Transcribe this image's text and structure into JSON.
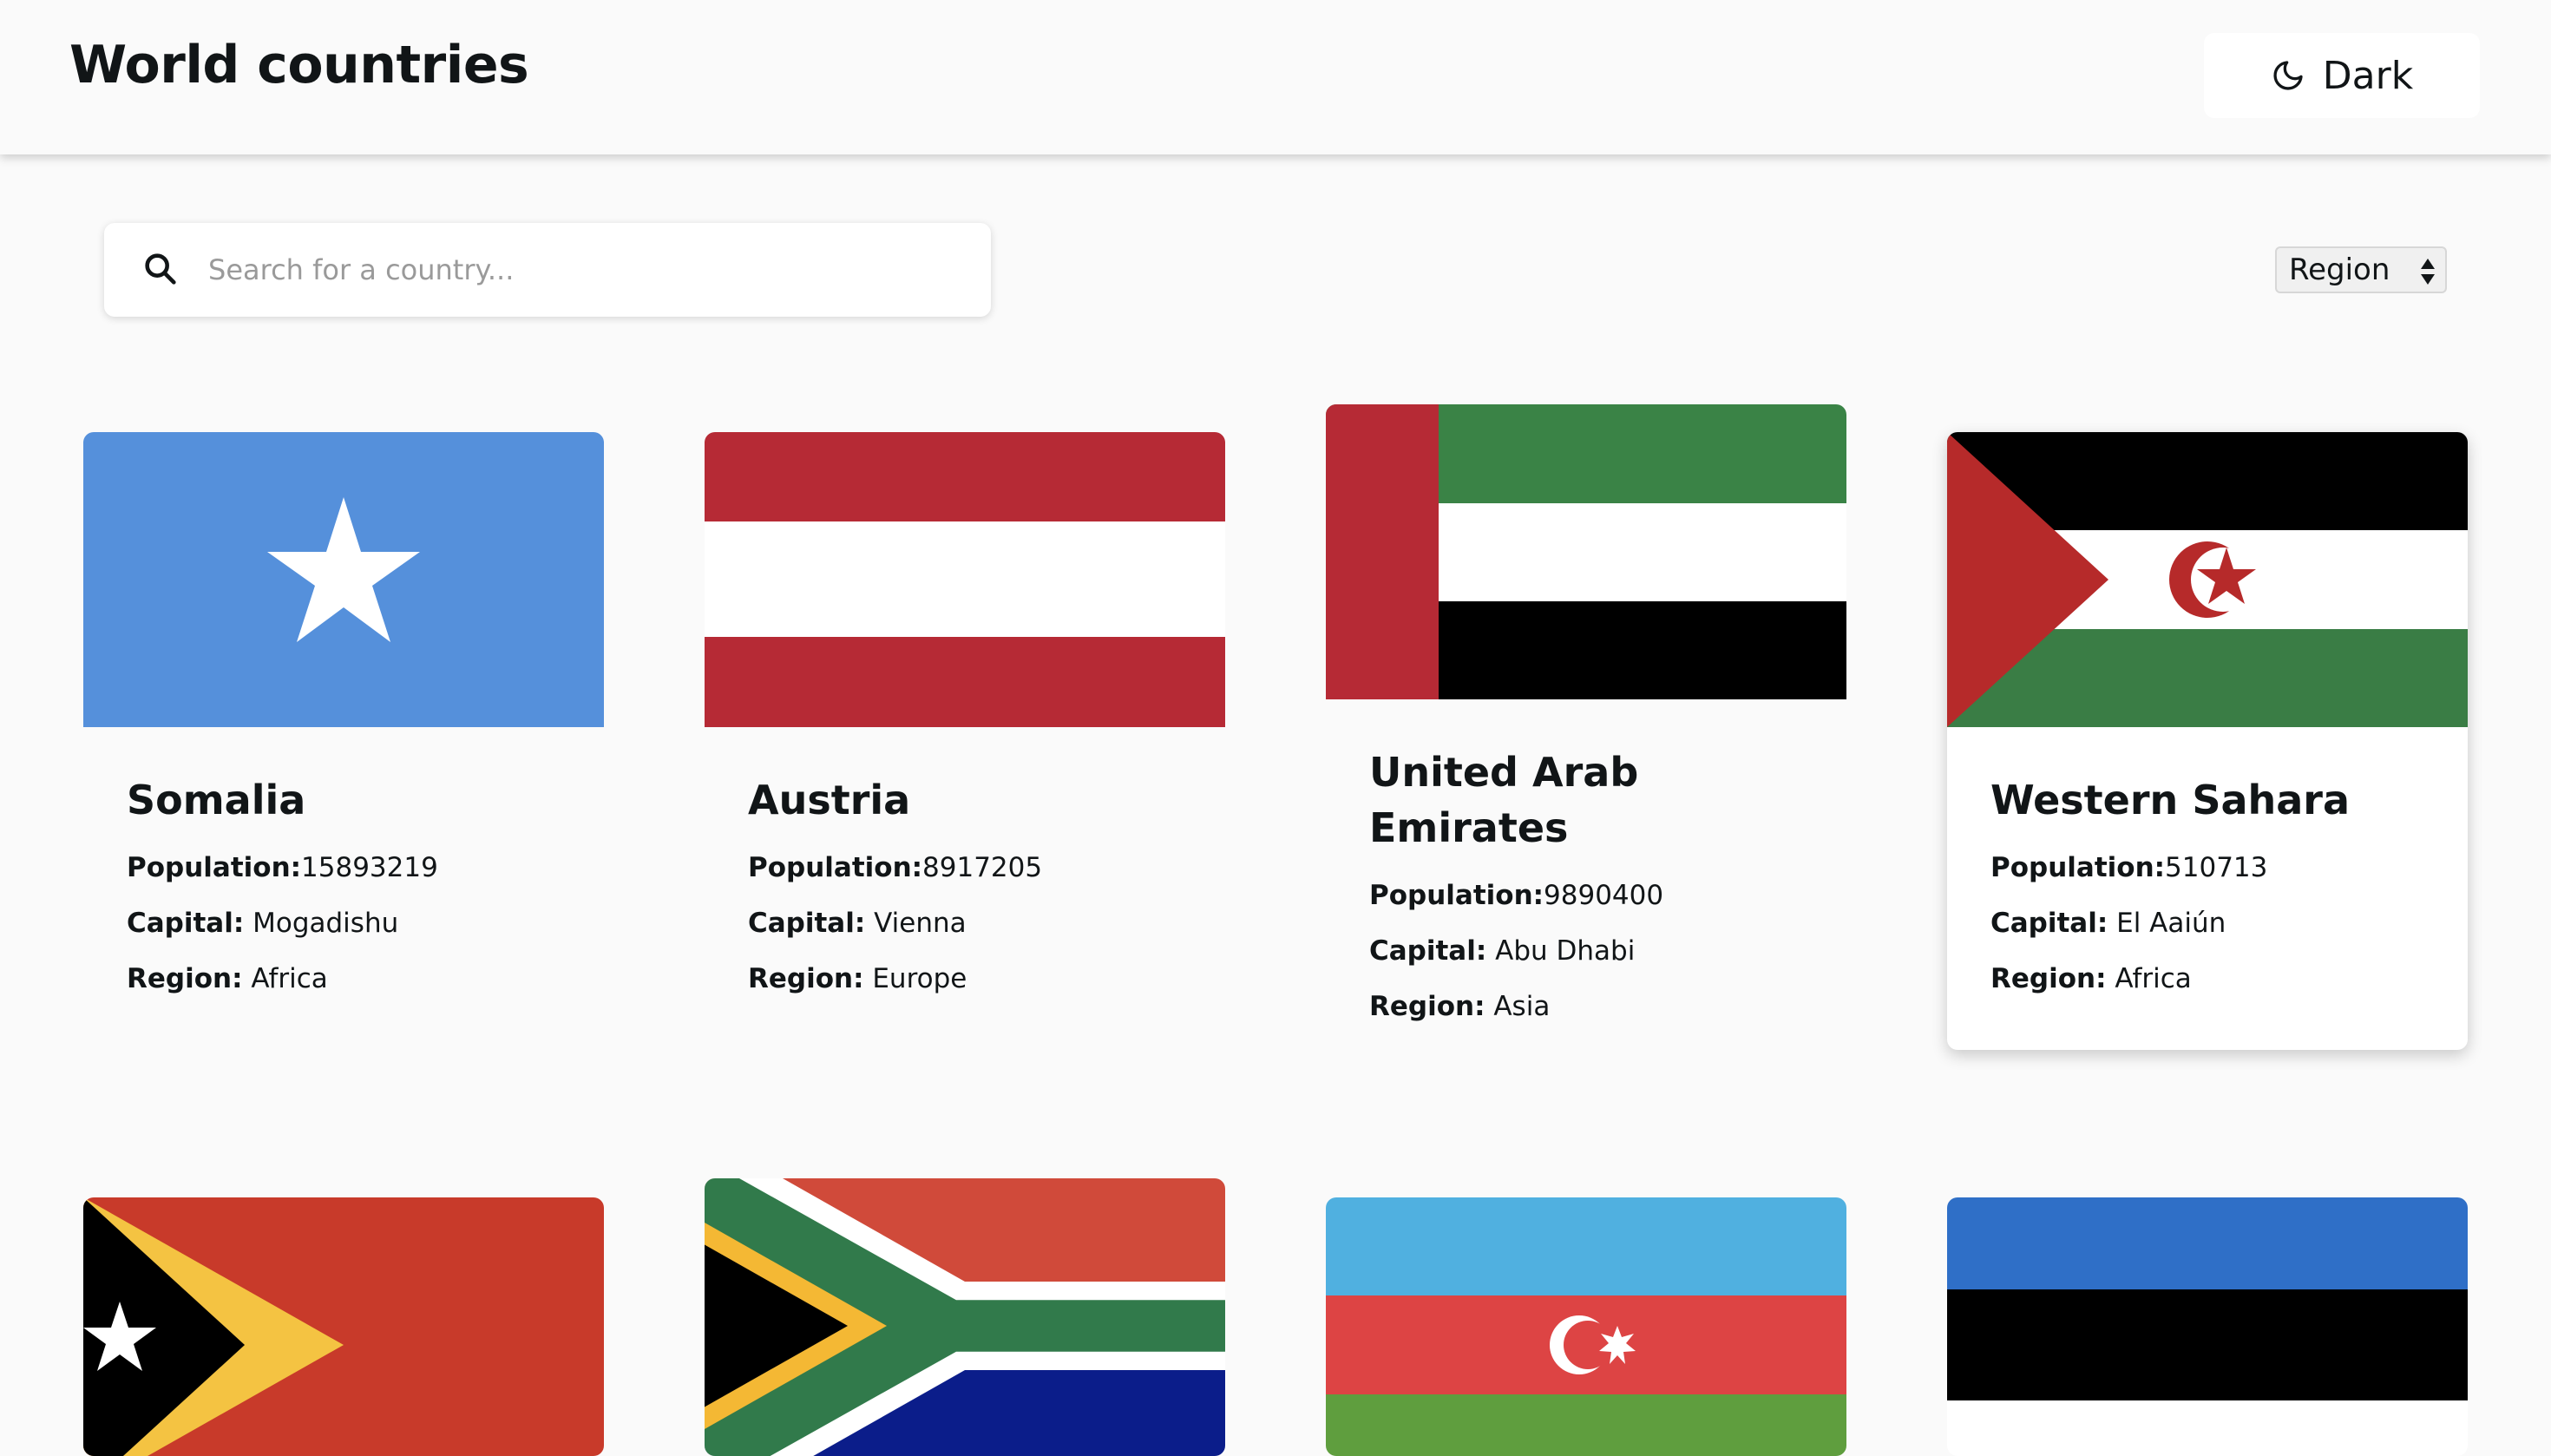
{
  "header": {
    "title": "World countries",
    "theme_label": "Dark"
  },
  "search": {
    "placeholder": "Search for a country..."
  },
  "filter": {
    "selected": "Region"
  },
  "labels": {
    "population": "Population:",
    "capital": "Capital:",
    "region": "Region:"
  },
  "countries": [
    {
      "name": "Somalia",
      "population": "15893219",
      "capital": "Mogadishu",
      "region": "Africa",
      "flag": "somalia-flag"
    },
    {
      "name": "Austria",
      "population": "8917205",
      "capital": "Vienna",
      "region": "Europe",
      "flag": "austria-flag"
    },
    {
      "name": "United Arab Emirates",
      "population": "9890400",
      "capital": "Abu Dhabi",
      "region": "Asia",
      "flag": "uae-flag"
    },
    {
      "name": "Western Sahara",
      "population": "510713",
      "capital": "El Aaiún",
      "region": "Africa",
      "flag": "western-sahara-flag"
    },
    {
      "flag": "timor-leste-flag"
    },
    {
      "flag": "south-africa-flag"
    },
    {
      "flag": "azerbaijan-flag"
    },
    {
      "flag": "estonia-flag"
    }
  ],
  "colors": {
    "background": "#fafafa",
    "text": "#111517",
    "placeholder": "#9a9a9a"
  }
}
